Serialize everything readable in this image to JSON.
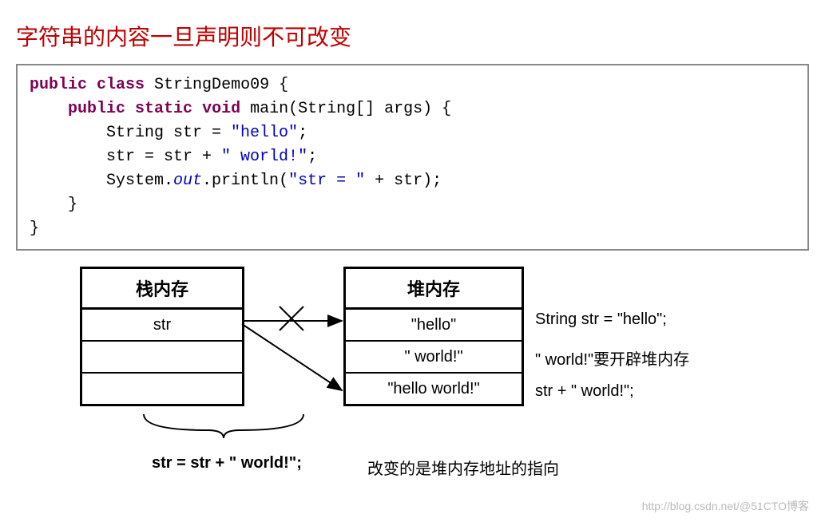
{
  "title": "字符串的内容一旦声明则不可改变",
  "code": {
    "line1": {
      "kw1": "public",
      "kw2": "class",
      "rest": " StringDemo09 {"
    },
    "line2": {
      "kw1": "public",
      "kw2": "static",
      "kw3": "void",
      "rest": " main(String[] args) {"
    },
    "line3": {
      "pre": "        String str = ",
      "str": "\"hello\"",
      "post": ";"
    },
    "line4": {
      "pre": "        str = str + ",
      "str": "\" world!\"",
      "post": ";"
    },
    "line5": {
      "pre": "        System.",
      "out": "out",
      "mid": ".println(",
      "str": "\"str = \"",
      "post": " + str);"
    },
    "line6": "    }",
    "line7": "}"
  },
  "stack": {
    "header": "栈内存",
    "rows": [
      "str",
      "",
      ""
    ]
  },
  "heap": {
    "header": "堆内存",
    "rows": [
      "\"hello\"",
      "\" world!\"",
      "\"hello world!\""
    ]
  },
  "side_labels": [
    "String str = \"hello\";",
    "\" world!\"要开辟堆内存",
    "str + \" world!\";"
  ],
  "bottom": {
    "expr": "str = str + \" world!\";",
    "note": "改变的是堆内存地址的指向"
  },
  "watermark": "http://blog.csdn.net/@51CTO博客"
}
